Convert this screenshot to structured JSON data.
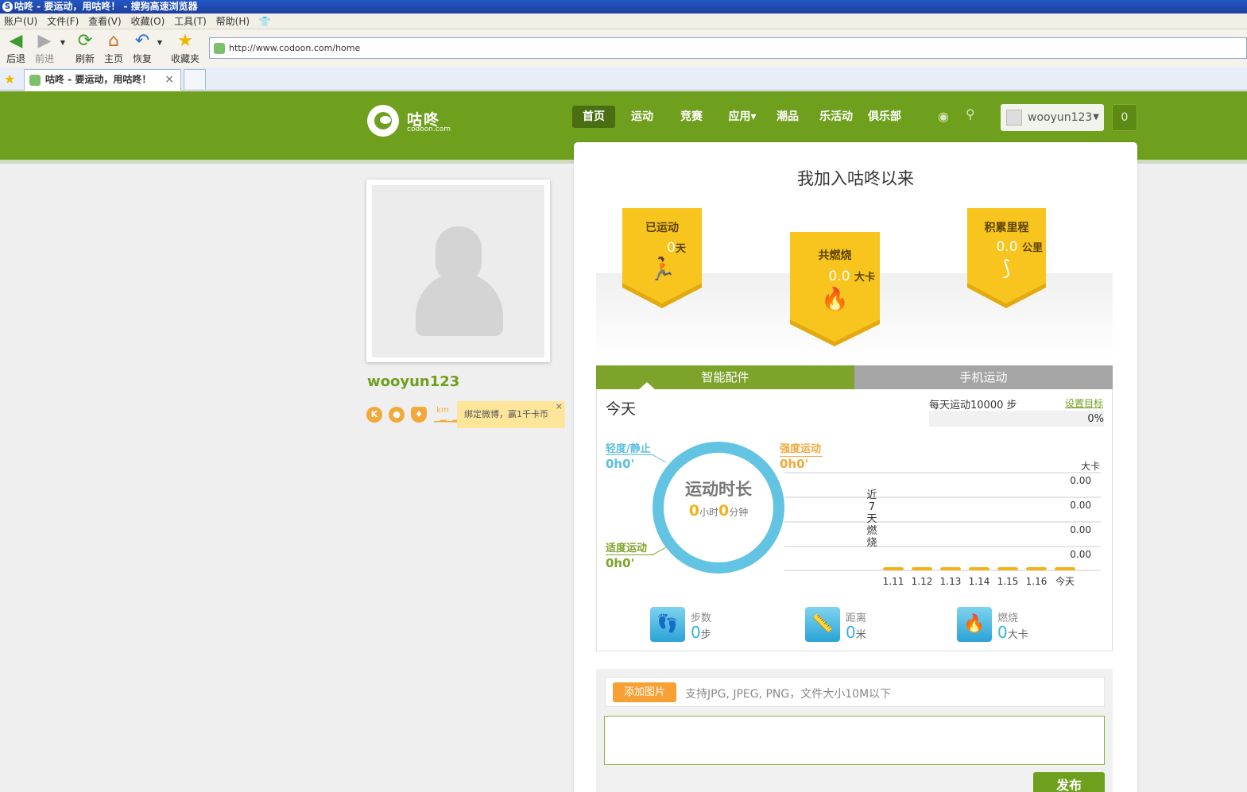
{
  "window": {
    "title": "咕咚 - 要运动，用咕咚！ - 搜狗高速浏览器"
  },
  "menu": [
    "账户(U)",
    "文件(F)",
    "查看(V)",
    "收藏(O)",
    "工具(T)",
    "帮助(H)"
  ],
  "toolbar": {
    "back": "后退",
    "forward": "前进",
    "refresh": "刷新",
    "home": "主页",
    "restore": "恢复",
    "favorites": "收藏夹"
  },
  "address": {
    "url": "http://www.codoon.com/home"
  },
  "tab": {
    "title": "咕咚 - 要运动，用咕咚！",
    "close": "×"
  },
  "site": {
    "logo_text": "咕咚",
    "logo_sub": "codoon.com",
    "nav": [
      "首页",
      "运动",
      "竞赛",
      "应用▾",
      "潮品",
      "乐活动",
      "俱乐部"
    ],
    "user": "wooyun123",
    "msg_count": "0"
  },
  "profile": {
    "username": "wooyun123",
    "badge_k": "K",
    "km_top": "km",
    "weibo_tip": "绑定微博，赢1千卡币",
    "weibo_close": "×"
  },
  "summary": {
    "title": "我加入咕咚以来",
    "exercised": {
      "label": "已运动",
      "value": "0",
      "unit": "天"
    },
    "burned": {
      "label": "共燃烧",
      "value": "0.0",
      "unit": "大卡"
    },
    "distance": {
      "label": "积累里程",
      "value": "0.0",
      "unit": "公里"
    }
  },
  "tabs": {
    "smart": "智能配件",
    "phone": "手机运动"
  },
  "today": {
    "label": "今天",
    "goal_text": "每天运动10000 步",
    "set_goal": "设置目标",
    "progress": "0%",
    "progress_fraction": 0,
    "light_label": "轻度/静止",
    "light_value": "0h0'",
    "intense_label": "强度运动",
    "intense_value": "0h0'",
    "moderate_label": "适度运动",
    "moderate_value": "0h0'",
    "ring_title": "运动时长",
    "ring_hours": "0",
    "ring_h_unit": "小时",
    "ring_mins": "0",
    "ring_m_unit": "分钟"
  },
  "chart_data": {
    "type": "bar",
    "title": "近7天燃烧",
    "ylabel": "大卡",
    "categories": [
      "1.11",
      "1.12",
      "1.13",
      "1.14",
      "1.15",
      "1.16",
      "今天"
    ],
    "values": [
      0,
      0,
      0,
      0,
      0,
      0,
      0
    ],
    "y_ticks": [
      "0.00",
      "0.00",
      "0.00",
      "0.00"
    ],
    "grid": true
  },
  "stats": {
    "steps": {
      "label": "步数",
      "value": "0",
      "unit": "步"
    },
    "distance": {
      "label": "距离",
      "value": "0",
      "unit": "米"
    },
    "burn": {
      "label": "燃烧",
      "value": "0",
      "unit": "大卡"
    }
  },
  "post": {
    "add_image": "添加图片",
    "hint": "支持JPG, JPEG, PNG，文件大小10M以下",
    "publish": "发布"
  },
  "colors": {
    "green": "#6e9f1d",
    "ring_blue": "#63c3e3",
    "banner_yellow": "#f8c41e",
    "orange": "#f7a033"
  }
}
